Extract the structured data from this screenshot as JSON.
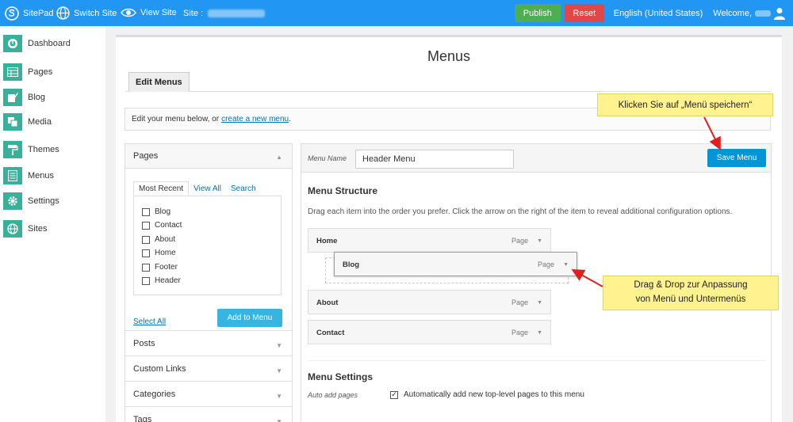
{
  "topbar": {
    "brand": "SitePad",
    "switch_site": "Switch Site",
    "view_site": "View Site",
    "site_label": "Site :",
    "publish": "Publish",
    "reset": "Reset",
    "language": "English (United States)",
    "welcome": "Welcome,",
    "color": "#2196f3"
  },
  "sidebar": {
    "items": [
      {
        "label": "Dashboard",
        "icon": "dashboard-icon"
      },
      {
        "label": "Pages",
        "icon": "pages-icon"
      },
      {
        "label": "Blog",
        "icon": "blog-icon"
      },
      {
        "label": "Media",
        "icon": "media-icon"
      },
      {
        "label": "Themes",
        "icon": "themes-icon"
      },
      {
        "label": "Menus",
        "icon": "menus-icon"
      },
      {
        "label": "Settings",
        "icon": "settings-icon"
      },
      {
        "label": "Sites",
        "icon": "sites-icon"
      }
    ]
  },
  "main": {
    "title": "Menus",
    "tab": "Edit Menus",
    "info_text": "Edit your menu below, or",
    "info_link": "create a new menu",
    "info_end": "."
  },
  "left_panel": {
    "pages_heading": "Pages",
    "subtabs": [
      "Most Recent",
      "View All",
      "Search"
    ],
    "pages": [
      "Blog",
      "Contact",
      "About",
      "Home",
      "Footer",
      "Header"
    ],
    "select_all": "Select All",
    "add_to_menu": "Add to Menu",
    "sections": [
      "Posts",
      "Custom Links",
      "Categories",
      "Tags"
    ]
  },
  "menu_editor": {
    "menu_name_label": "Menu Name",
    "menu_name_value": "Header Menu",
    "save_menu": "Save Menu",
    "structure_title": "Menu Structure",
    "structure_desc": "Drag each item into the order you prefer. Click the arrow on the right of the item to reveal additional configuration options.",
    "items": [
      {
        "title": "Home",
        "type": "Page"
      },
      {
        "title": "Blog",
        "type": "Page"
      },
      {
        "title": "About",
        "type": "Page"
      },
      {
        "title": "Contact",
        "type": "Page"
      }
    ],
    "settings_title": "Menu Settings",
    "auto_add_label": "Auto add pages",
    "auto_add_text": "Automatically add new top-level pages to this menu"
  },
  "callouts": {
    "save_hint": "Klicken Sie auf „Menü speichern“",
    "drag_hint_1": "Drag & Drop zur Anpassung",
    "drag_hint_2": "von Menü und Untermenüs"
  }
}
